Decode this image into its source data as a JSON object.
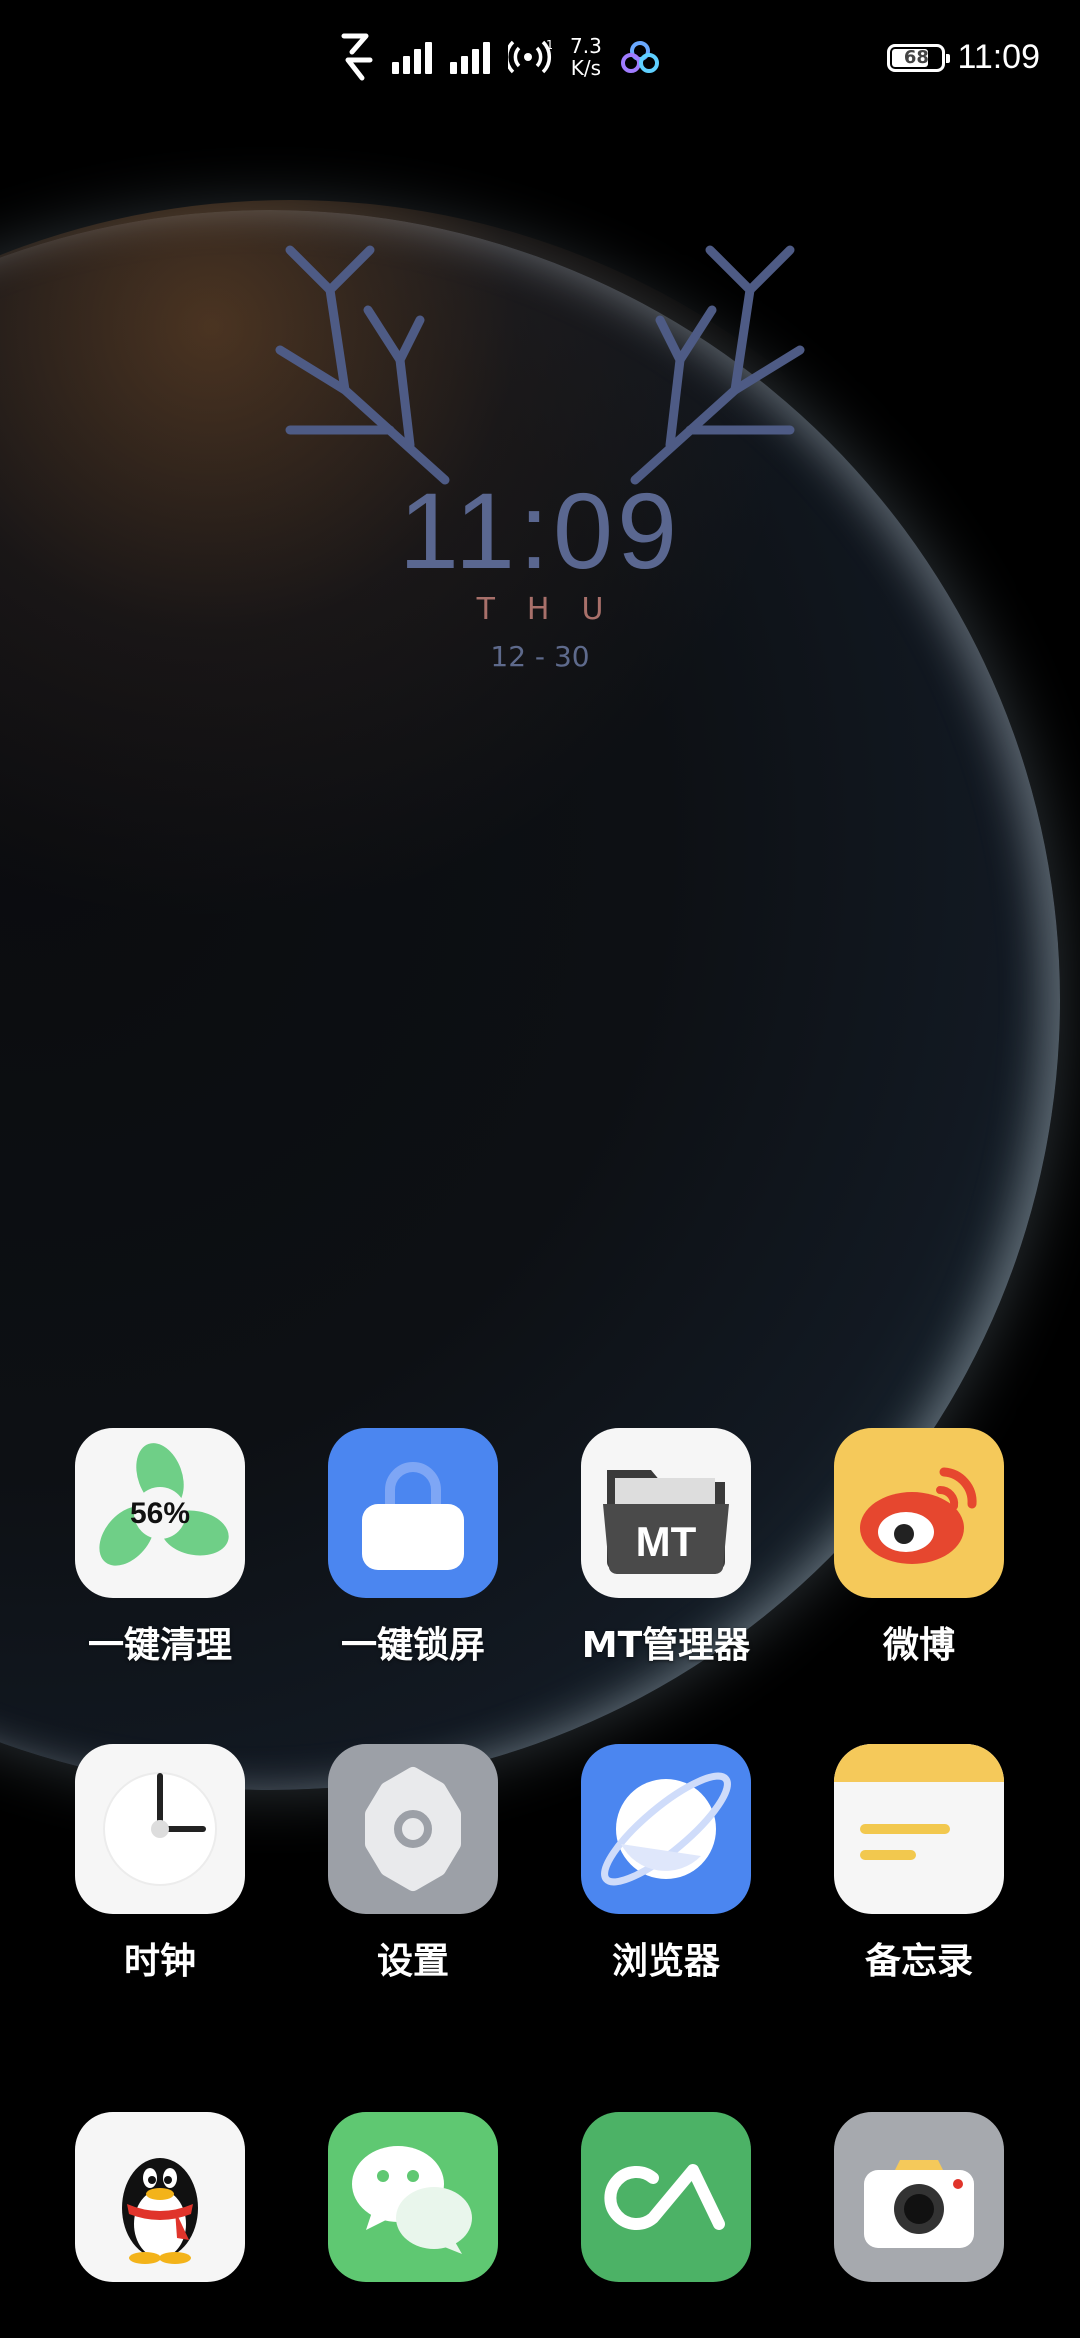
{
  "status_bar": {
    "net_speed_value": "7.3",
    "net_speed_unit": "K/s",
    "battery_level": "68",
    "time": "11:09"
  },
  "clock_widget": {
    "time": "11:09",
    "day": "THU",
    "date": "12 - 30"
  },
  "apps": [
    {
      "label": "一键清理",
      "icon": "fan-clean-icon",
      "badge": "56%"
    },
    {
      "label": "一键锁屏",
      "icon": "lock-icon"
    },
    {
      "label": "MT管理器",
      "icon": "mt-folder-icon",
      "icon_text": "MT"
    },
    {
      "label": "微博",
      "icon": "weibo-icon"
    },
    {
      "label": "时钟",
      "icon": "clock-icon"
    },
    {
      "label": "设置",
      "icon": "settings-gear-icon"
    },
    {
      "label": "浏览器",
      "icon": "browser-planet-icon"
    },
    {
      "label": "备忘录",
      "icon": "notes-icon"
    }
  ],
  "dock": [
    {
      "icon": "qq-penguin-icon"
    },
    {
      "icon": "wechat-icon"
    },
    {
      "icon": "share-app-icon"
    },
    {
      "icon": "camera-icon"
    }
  ],
  "colors": {
    "widget_time": "#5a6790",
    "widget_day": "#a8706a",
    "widget_date": "#5e6a8c"
  }
}
